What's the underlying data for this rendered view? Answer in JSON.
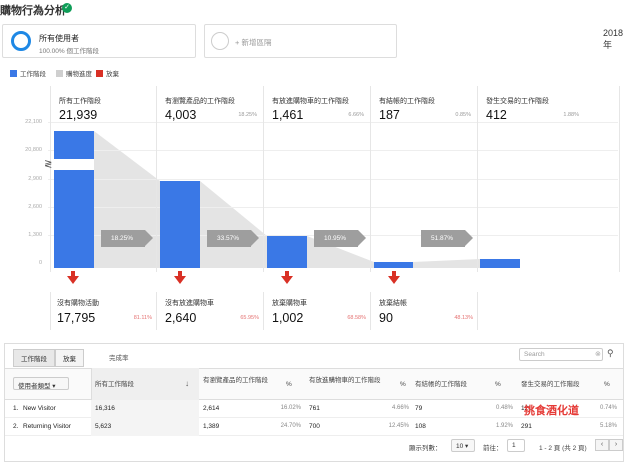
{
  "page_title": "購物行為分析",
  "segments": {
    "active_name": "所有使用者",
    "active_sub": "100.00% 個工作階段",
    "add_label": "+ 新增區隔"
  },
  "date_text": "2018年",
  "legend": [
    {
      "label": "工作階段",
      "color": "#3a78e6"
    },
    {
      "label": "購物進度",
      "color": "#cfcfcf"
    },
    {
      "label": "放棄",
      "color": "#d93025"
    }
  ],
  "funnel_headers": [
    {
      "label": "所有工作階段",
      "value": "21,939",
      "pct": ""
    },
    {
      "label": "有瀏覽產品的工作階段",
      "value": "4,003",
      "pct": "18.25%"
    },
    {
      "label": "有放進購物車的工作階段",
      "value": "1,461",
      "pct": "6.66%"
    },
    {
      "label": "有結帳的工作階段",
      "value": "187",
      "pct": "0.85%"
    },
    {
      "label": "發生交易的工作階段",
      "value": "412",
      "pct": "1.88%"
    }
  ],
  "y_ticks": [
    "22,100",
    "20,800",
    "2,900",
    "2,600",
    "1,300",
    "0"
  ],
  "arrows": [
    "18.25%",
    "33.57%",
    "10.95%",
    "51.87%"
  ],
  "dropoffs": [
    {
      "label": "沒有購物活動",
      "value": "17,795",
      "pct": "81.11%"
    },
    {
      "label": "沒有放進購物車",
      "value": "2,640",
      "pct": "65.95%"
    },
    {
      "label": "放棄購物車",
      "value": "1,002",
      "pct": "68.58%"
    },
    {
      "label": "放棄結帳",
      "value": "90",
      "pct": "48.13%"
    }
  ],
  "table": {
    "tabs": [
      "工作階段",
      "放棄",
      "完成率"
    ],
    "search_placeholder": "Search",
    "dim_select": "使用者類型",
    "headers": [
      "所有工作階段",
      "有瀏覽產品的工作階段",
      "%",
      "有放進購物車的工作階段",
      "%",
      "有結帳的工作階段",
      "%",
      "發生交易的工作階段",
      "%"
    ],
    "rows": [
      {
        "idx": "1.",
        "name": "New Visitor",
        "all": "16,316",
        "view": "2,614",
        "view_pct": "16.02%",
        "cart": "761",
        "cart_pct": "4.66%",
        "checkout": "79",
        "checkout_pct": "0.48%",
        "tx": "121",
        "tx_pct": "0.74%"
      },
      {
        "idx": "2.",
        "name": "Returning Visitor",
        "all": "5,623",
        "view": "1,389",
        "view_pct": "24.70%",
        "cart": "700",
        "cart_pct": "12.45%",
        "checkout": "108",
        "checkout_pct": "1.92%",
        "tx": "291",
        "tx_pct": "5.18%"
      }
    ],
    "rows_label": "顯示列數：",
    "rows_value": "10",
    "goto_label": "前往：",
    "goto_value": "1",
    "range": "1 - 2 頁 (共 2 頁)"
  },
  "watermark": "挑食酒化道"
}
